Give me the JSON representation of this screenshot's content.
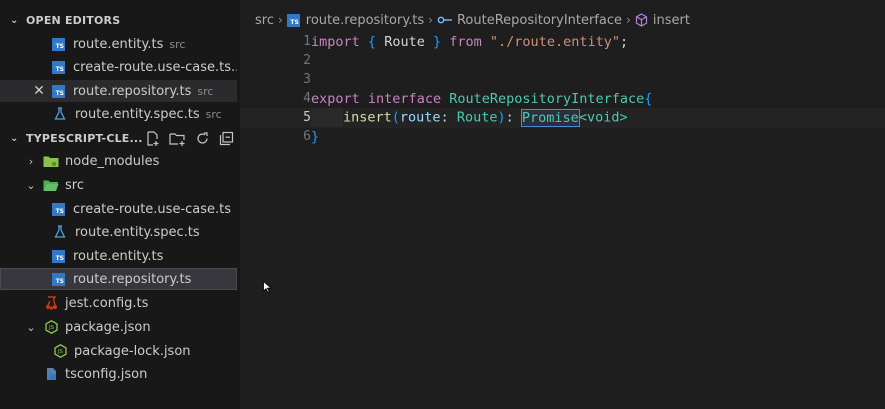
{
  "sidebar": {
    "open_editors_title": "OPEN EDITORS",
    "open_editors": [
      {
        "label": "route.entity.ts",
        "desc": "src"
      },
      {
        "label": "create-route.use-case.ts...",
        "desc": ""
      },
      {
        "label": "route.repository.ts",
        "desc": "src"
      },
      {
        "label": "route.entity.spec.ts",
        "desc": "src"
      }
    ],
    "explorer_title": "TYPESCRIPT-CLE...",
    "tree": [
      {
        "label": "node_modules",
        "type": "folder-collapsed"
      },
      {
        "label": "src",
        "type": "folder-open"
      },
      {
        "label": "create-route.use-case.ts",
        "type": "ts"
      },
      {
        "label": "route.entity.spec.ts",
        "type": "test"
      },
      {
        "label": "route.entity.ts",
        "type": "ts"
      },
      {
        "label": "route.repository.ts",
        "type": "ts"
      },
      {
        "label": "jest.config.ts",
        "type": "jest"
      },
      {
        "label": "package.json",
        "type": "json"
      },
      {
        "label": "package-lock.json",
        "type": "json"
      },
      {
        "label": "tsconfig.json",
        "type": "tsconfig"
      }
    ],
    "ts_badge": "TS"
  },
  "breadcrumb": {
    "folder": "src",
    "file": "route.repository.ts",
    "interface": "RouteRepositoryInterface",
    "method": "insert"
  },
  "code": {
    "line_numbers": [
      "1",
      "2",
      "3",
      "4",
      "5",
      "6"
    ],
    "l1": {
      "import": "import",
      "open": "{",
      "name": "Route",
      "close": "}",
      "from": "from",
      "path": "\"./route.entity\"",
      "semi": ";"
    },
    "l4": {
      "export": "export",
      "interface": "interface",
      "name": "RouteRepositoryInterface",
      "brace": "{"
    },
    "l5": {
      "method": "insert",
      "paren_open": "(",
      "param": "route",
      "colon": ":",
      "type": "Route",
      "paren_close": ")",
      "colon2": ":",
      "promise": "Promise",
      "generic": "<void>"
    },
    "l6": {
      "brace": "}"
    }
  }
}
